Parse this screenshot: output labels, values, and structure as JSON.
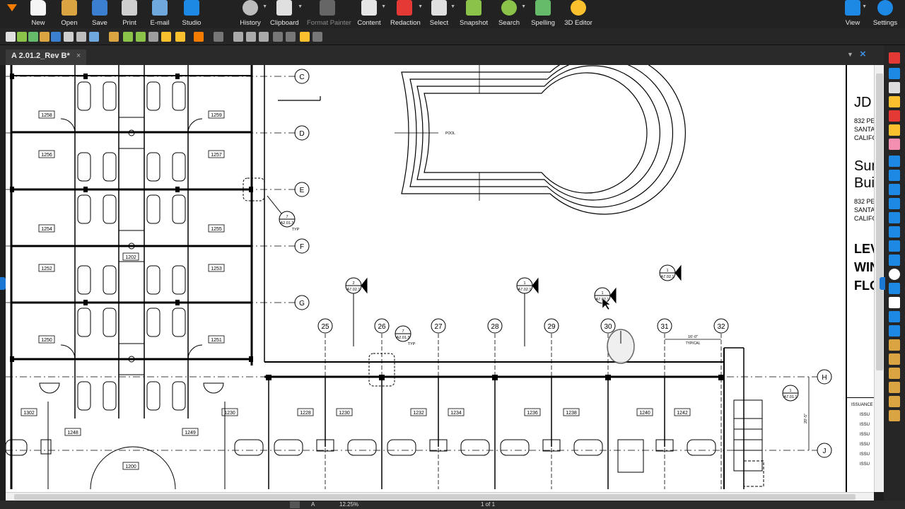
{
  "ribbon": {
    "buttons": [
      {
        "name": "new",
        "label": "New",
        "color": "#f0c040"
      },
      {
        "name": "open",
        "label": "Open",
        "color": "#d9a441"
      },
      {
        "name": "save",
        "label": "Save",
        "color": "#3a7fd0"
      },
      {
        "name": "print",
        "label": "Print",
        "color": "#cfcfcf"
      },
      {
        "name": "email",
        "label": "E-mail",
        "color": "#6fa8dc"
      },
      {
        "name": "studio",
        "label": "Studio",
        "color": "#1e88e5"
      },
      {
        "name": "history",
        "label": "History",
        "color": "#bdbdbd"
      },
      {
        "name": "clipboard",
        "label": "Clipboard",
        "color": "#e0e0e0"
      },
      {
        "name": "format-painter",
        "label": "Format Painter",
        "color": "#777"
      },
      {
        "name": "content",
        "label": "Content",
        "color": "#e6e6e6"
      },
      {
        "name": "redaction",
        "label": "Redaction",
        "color": "#e53935"
      },
      {
        "name": "select",
        "label": "Select",
        "color": "#e0e0e0"
      },
      {
        "name": "snapshot",
        "label": "Snapshot",
        "color": "#8bc34a"
      },
      {
        "name": "search",
        "label": "Search",
        "color": "#8bc34a"
      },
      {
        "name": "spelling",
        "label": "Spelling",
        "color": "#66bb6a"
      },
      {
        "name": "3d-editor",
        "label": "3D Editor",
        "color": "#fbc02d"
      },
      {
        "name": "view",
        "label": "View",
        "color": "#1e88e5"
      },
      {
        "name": "settings",
        "label": "Settings",
        "color": "#1e88e5"
      }
    ]
  },
  "document_tab": {
    "title": "A 2.01.2_Rev B*",
    "close": "×"
  },
  "window_controls": {
    "close": "×"
  },
  "drawing": {
    "grid_rows": [
      "C",
      "D",
      "E",
      "F",
      "G",
      "H",
      "J"
    ],
    "grid_cols": [
      "25",
      "26",
      "27",
      "28",
      "29",
      "30",
      "31",
      "32"
    ],
    "rooms_left": [
      "1258",
      "1259",
      "1256",
      "1257",
      "1254",
      "1255",
      "1252",
      "1253",
      "1250",
      "1251"
    ],
    "rooms_center": [
      "1202",
      "1200"
    ],
    "rooms_bottom": [
      "1302",
      "1248",
      "1249",
      "1230",
      "1228",
      "1230",
      "1232",
      "1234",
      "1236",
      "1238",
      "1240",
      "1242"
    ],
    "pool_label": "POOL",
    "section_refs": [
      {
        "num": "7",
        "sheet": "A2.01.3",
        "note": "TYP"
      },
      {
        "num": "2",
        "sheet": "A7.02.1"
      },
      {
        "num": "1",
        "sheet": "A7.02.1"
      },
      {
        "num": "1",
        "sheet": "A7.02.1"
      },
      {
        "num": "1",
        "sheet": "A7.02.1"
      },
      {
        "num": "7",
        "sheet": "A2.01.3",
        "note": "TYP"
      },
      {
        "num": "1",
        "sheet": "A7.01.1"
      }
    ],
    "dimension": {
      "text": "16'-0\"",
      "note": "TYPICAL"
    },
    "side_dim": "20'-5\""
  },
  "title_block": {
    "firm": "JD I",
    "address_lines": [
      "832 PE",
      "SANTA",
      "CALIFO"
    ],
    "project": [
      "Sun",
      "Buil"
    ],
    "project_address": [
      "832 PE",
      "SANTA",
      "CALIFO"
    ],
    "sheet_title": [
      "LEV",
      "WIN",
      "FLO"
    ],
    "issuance_header": "ISSUANCE",
    "issuance_rows": [
      "ISSU",
      "ISSU",
      "ISSU",
      "ISSU",
      "ISSU",
      "ISSU"
    ]
  },
  "statusbar": {
    "zoom": "12.25%",
    "page": "1 of 1"
  }
}
